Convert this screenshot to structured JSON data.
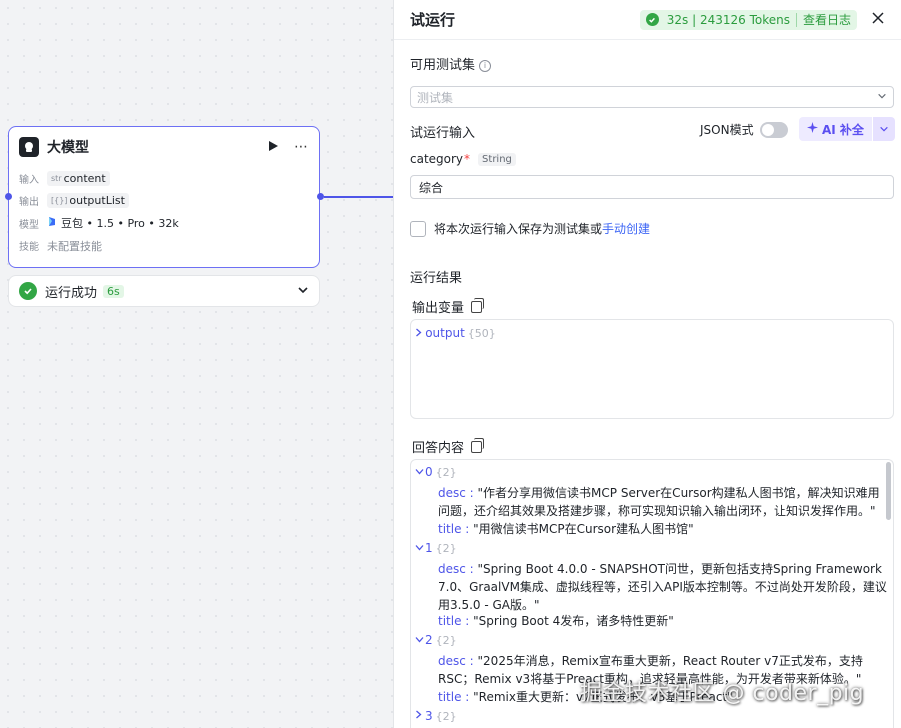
{
  "node": {
    "title": "大模型",
    "input_label": "输入",
    "input_type": "str",
    "input_value": "content",
    "output_label": "输出",
    "output_type": "[{}]",
    "output_value": "outputList",
    "model_label": "模型",
    "model_value": "豆包 • 1.5 • Pro • 32k",
    "skill_label": "技能",
    "skill_value": "未配置技能"
  },
  "status": {
    "text": "运行成功",
    "duration": "6s"
  },
  "panel": {
    "title": "试运行",
    "tokens": "32s | 243126 Tokens",
    "view_log": "查看日志",
    "testset_label": "可用测试集",
    "testset_placeholder": "测试集",
    "run_input_label": "试运行输入",
    "json_mode": "JSON模式",
    "ai_complete": "AI 补全",
    "field_name": "category",
    "field_type": "String",
    "field_value": "综合",
    "save_text": "将本次运行输入保存为测试集或",
    "manual_create": "手动创建",
    "result_label": "运行结果",
    "output_var_label": "输出变量",
    "output_key": "output",
    "output_count": "{50}",
    "answer_label": "回答内容"
  },
  "answer": {
    "items": [
      {
        "index": "0",
        "count": "{2}",
        "desc_key": "desc",
        "desc": "\"作者分享用微信读书MCP Server在Cursor构建私人图书馆，解决知识难用问题，还介绍其效果及搭建步骤，称可实现知识输入输出闭环，让知识发挥作用。\"",
        "title_key": "title",
        "title": "\"用微信读书MCP在Cursor建私人图书馆\""
      },
      {
        "index": "1",
        "count": "{2}",
        "desc_key": "desc",
        "desc": "\"Spring Boot 4.0.0 - SNAPSHOT问世，更新包括支持Spring Framework 7.0、GraalVM集成、虚拟线程等，还引入API版本控制等。不过尚处开发阶段，建议用3.5.0 - GA版。\"",
        "title_key": "title",
        "title": "\"Spring Boot 4发布，诸多特性更新\""
      },
      {
        "index": "2",
        "count": "{2}",
        "desc_key": "desc",
        "desc": "\"2025年消息，Remix宣布重大更新，React Router v7正式发布，支持RSC；Remix v3将基于Preact重构，追求轻量高性能，为开发者带来新体验。\"",
        "title_key": "title",
        "title": "\"Remix重大更新：v7正式发布、v3基于Preact\""
      },
      {
        "index": "3",
        "count": "{2}"
      }
    ]
  },
  "watermark": "掘金技术社区 @ coder_pig"
}
